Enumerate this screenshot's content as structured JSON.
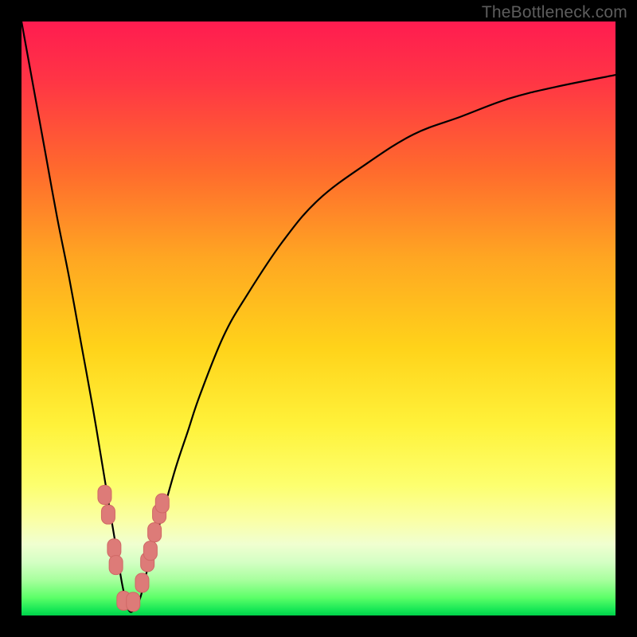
{
  "watermark": "TheBottleneck.com",
  "colors": {
    "curve": "#000000",
    "marker_fill": "#dd7b78",
    "marker_stroke": "#d06865",
    "frame": "#000000"
  },
  "chart_data": {
    "type": "line",
    "title": "",
    "xlabel": "",
    "ylabel": "",
    "xlim": [
      0,
      100
    ],
    "ylim": [
      0,
      100
    ],
    "note": "Axes carry no visible tick labels. Values are percentages of the plotting area (0,0 top-left in image terms). The y-series represents the V-shaped bottleneck curve height; lower x-range near ~18 is the minimum.",
    "series": [
      {
        "name": "bottleneck-curve",
        "x": [
          0,
          2,
          4,
          6,
          8,
          10,
          12,
          14,
          15,
          16,
          17,
          18,
          19,
          20,
          21,
          22,
          24,
          26,
          28,
          30,
          34,
          38,
          44,
          50,
          58,
          66,
          74,
          82,
          90,
          100
        ],
        "y": [
          100,
          89,
          78,
          67,
          57,
          46,
          35,
          23,
          17,
          11,
          5,
          1,
          1,
          3,
          7,
          11,
          18,
          25,
          31,
          37,
          47,
          54,
          63,
          70,
          76,
          81,
          84,
          87,
          89,
          91
        ]
      }
    ],
    "markers": {
      "name": "highlight-points",
      "points": [
        {
          "x": 14.0,
          "y_pct_from_top": 79.7
        },
        {
          "x": 14.6,
          "y_pct_from_top": 83.0
        },
        {
          "x": 15.6,
          "y_pct_from_top": 88.7
        },
        {
          "x": 15.9,
          "y_pct_from_top": 91.5
        },
        {
          "x": 17.2,
          "y_pct_from_top": 97.5
        },
        {
          "x": 18.8,
          "y_pct_from_top": 97.7
        },
        {
          "x": 20.3,
          "y_pct_from_top": 94.5
        },
        {
          "x": 21.2,
          "y_pct_from_top": 91.0
        },
        {
          "x": 21.7,
          "y_pct_from_top": 89.1
        },
        {
          "x": 22.4,
          "y_pct_from_top": 86.0
        },
        {
          "x": 23.2,
          "y_pct_from_top": 82.9
        },
        {
          "x": 23.7,
          "y_pct_from_top": 81.1
        }
      ]
    }
  }
}
